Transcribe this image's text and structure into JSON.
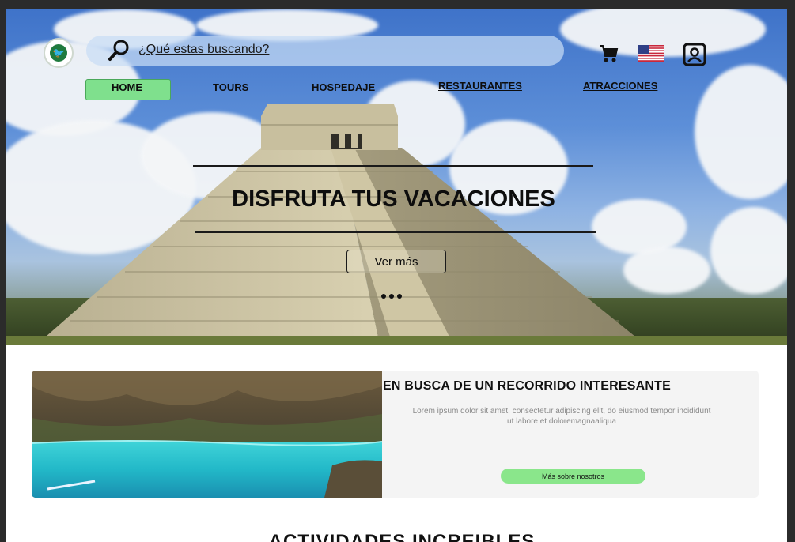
{
  "header": {
    "search_placeholder": "¿Qué estas buscando?"
  },
  "nav": {
    "items": [
      {
        "label": "HOME",
        "active": true
      },
      {
        "label": "TOURS"
      },
      {
        "label": "HOSPEDAJE"
      },
      {
        "label": "RESTAURANTES"
      },
      {
        "label": "ATRACCIONES"
      }
    ]
  },
  "hero": {
    "title": "DISFRUTA TUS VACACIONES",
    "button_label": "Ver más"
  },
  "feature": {
    "title": "EN BUSCA DE UN RECORRIDO INTERESANTE",
    "body": "Lorem ipsum dolor sit amet,     consectetur adipiscing elit, do eiusmod tempor incididunt ut labore et doloremagnaaliqua",
    "button_label": "Más sobre nosotros"
  },
  "sections": {
    "activities_title": "ACTIVIDADES INCREIBLES"
  },
  "icons": {
    "search": "search-icon",
    "cart": "cart-icon",
    "flag": "us-flag-icon",
    "user": "user-icon",
    "logo": "logo-icon"
  },
  "colors": {
    "accent_green": "#7fe08d",
    "sky": "#4f80d0",
    "card_bg": "#f4f4f4"
  }
}
